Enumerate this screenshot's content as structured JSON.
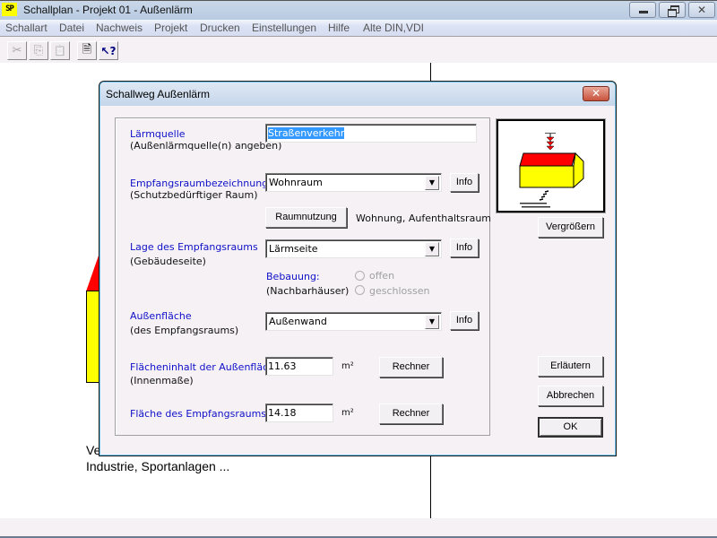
{
  "window": {
    "app_icon_text": "SP",
    "title": "Schallplan  - Projekt 01 - Außenlärm",
    "controls": {
      "minimize": "minimize",
      "restore": "restore",
      "close": "✕"
    }
  },
  "menu": {
    "items": [
      "Schallart",
      "Datei",
      "Nachweis",
      "Projekt",
      "Drucken",
      "Einstellungen",
      "Hilfe",
      "Alte DIN,VDI"
    ]
  },
  "toolbar": {
    "buttons": [
      {
        "name": "cut",
        "glyph": "✂",
        "enabled": false
      },
      {
        "name": "copy",
        "glyph": "⎘",
        "enabled": false
      },
      {
        "name": "paste",
        "glyph": "📋",
        "enabled": false
      },
      {
        "name": "properties",
        "glyph": "🗎",
        "enabled": true
      },
      {
        "name": "context-help",
        "glyph": "↖?",
        "enabled": true
      }
    ]
  },
  "background": {
    "text_line1": "Ve",
    "text_line2": "Industrie, Sportanlagen ...",
    "colors": {
      "roof": "#ff0000",
      "wall": "#ffff00"
    }
  },
  "dialog": {
    "title": "Schallweg Außenlärm",
    "close_glyph": "✕",
    "fields": {
      "laermquelle": {
        "label": "Lärmquelle",
        "sublabel": "(Außenlärmquelle(n) angeben)",
        "value": "Straßenverkehr"
      },
      "empfangsraum": {
        "label": "Empfangsraumbezeichnung",
        "sublabel": "(Schutzbedürftiger Raum)",
        "value": "Wohnraum",
        "info_button": "Info"
      },
      "raumnutzung": {
        "button": "Raumnutzung",
        "value_text": "Wohnung, Aufenthaltsraum"
      },
      "lage": {
        "label": "Lage des Empfangsraums",
        "sublabel": "(Gebäudeseite)",
        "value": "Lärmseite",
        "info_button": "Info"
      },
      "bebauung": {
        "label": "Bebauung:",
        "sublabel": "(Nachbarhäuser)",
        "options": [
          {
            "label": "offen",
            "selected": false,
            "enabled": false
          },
          {
            "label": "geschlossen",
            "selected": false,
            "enabled": false
          }
        ]
      },
      "aussenflaeche": {
        "label": "Außenfläche",
        "sublabel": "(des Empfangsraums)",
        "value": "Außenwand",
        "info_button": "Info"
      },
      "flaecheninhalt": {
        "label": "Flächeninhalt der Außenfläche",
        "sublabel": "(Innenmaße)",
        "value": "11.63",
        "unit": "m²",
        "button": "Rechner"
      },
      "flaeche_empfangsraum": {
        "label": "Fläche des Empfangsraums",
        "value": "14.18",
        "unit": "m²",
        "button": "Rechner"
      }
    },
    "side_buttons": {
      "enlarge": "Vergrößern",
      "explain": "Erläutern",
      "cancel": "Abbrechen",
      "ok": "OK"
    },
    "preview_colors": {
      "roof": "#ff0000",
      "wall": "#ffff00",
      "arrow": "#ff0000"
    }
  }
}
